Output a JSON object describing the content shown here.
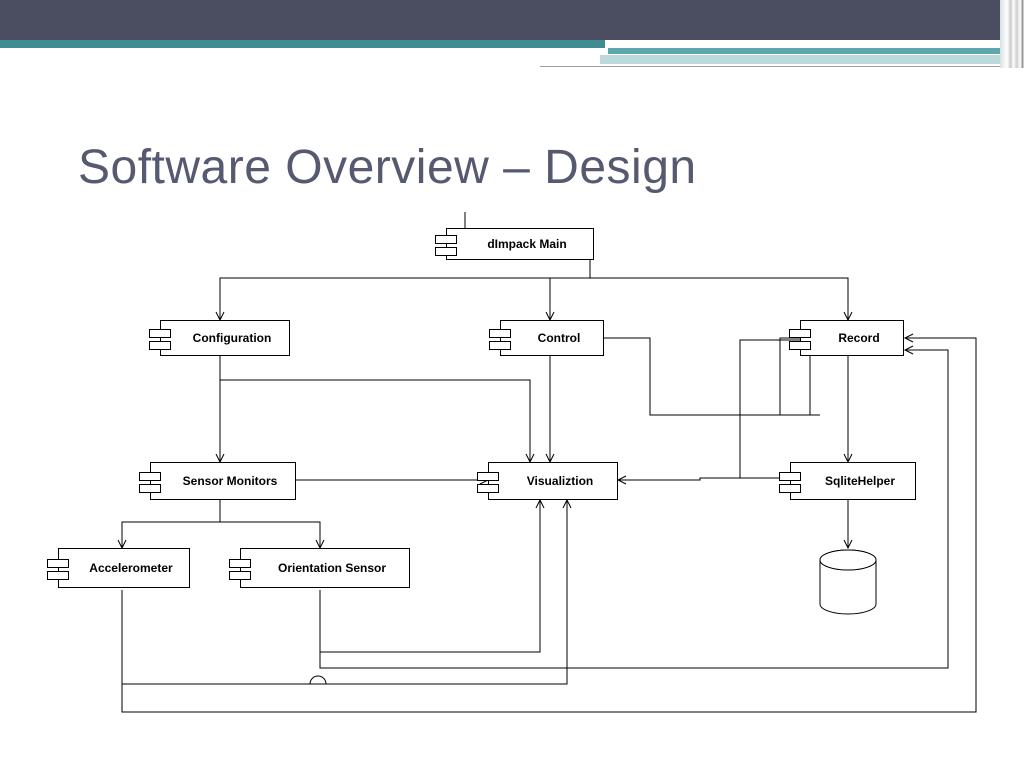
{
  "title": "Software Overview – Design",
  "components": {
    "main": {
      "label": "dImpack Main"
    },
    "configuration": {
      "label": "Configuration"
    },
    "control": {
      "label": "Control"
    },
    "record": {
      "label": "Record"
    },
    "sensor": {
      "label": "Sensor Monitors"
    },
    "visual": {
      "label": "Visualiztion"
    },
    "sqlite": {
      "label": "SqliteHelper"
    },
    "accel": {
      "label": "Accelerometer"
    },
    "orient": {
      "label": "Orientation Sensor"
    }
  },
  "connections": [
    {
      "from": "main",
      "to": "configuration"
    },
    {
      "from": "main",
      "to": "control"
    },
    {
      "from": "main",
      "to": "record"
    },
    {
      "from": "configuration",
      "to": "sensor"
    },
    {
      "from": "configuration",
      "to": "visual"
    },
    {
      "from": "control",
      "to": "visual"
    },
    {
      "from": "control",
      "to": "record"
    },
    {
      "from": "record",
      "to": "sqlite"
    },
    {
      "from": "record",
      "to": "visual"
    },
    {
      "from": "sensor",
      "to": "visual"
    },
    {
      "from": "sensor",
      "to": "accel"
    },
    {
      "from": "sensor",
      "to": "orient"
    },
    {
      "from": "sqlite",
      "to": "database"
    },
    {
      "from": "accel",
      "to": "visual"
    },
    {
      "from": "accel",
      "to": "record"
    },
    {
      "from": "orient",
      "to": "visual"
    },
    {
      "from": "orient",
      "to": "record"
    }
  ],
  "symbols": {
    "database": "database-cylinder"
  },
  "diagram_type": "uml-component-diagram"
}
